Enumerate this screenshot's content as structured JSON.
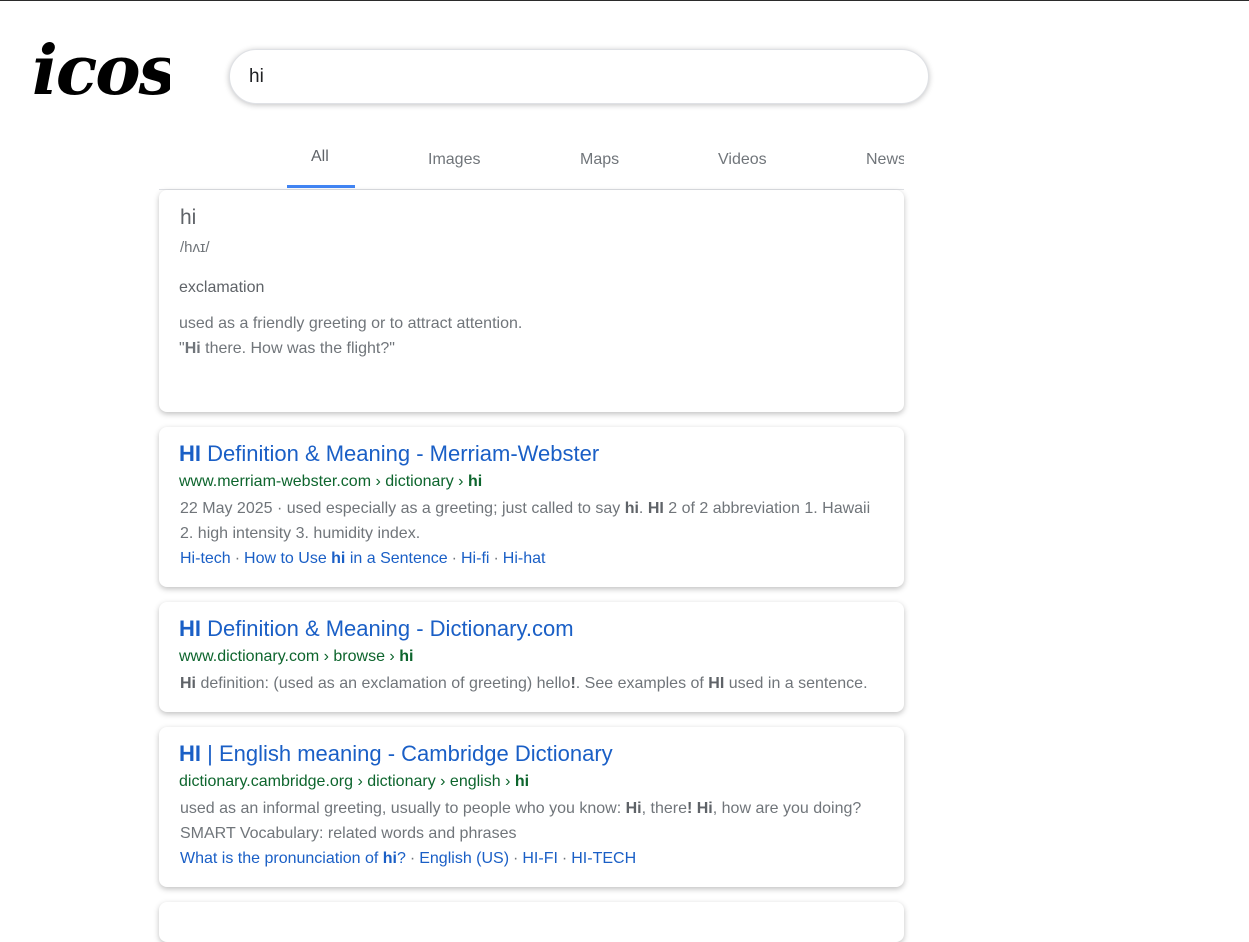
{
  "logo": {
    "text": "icos"
  },
  "search": {
    "value": "hi",
    "placeholder": ""
  },
  "tabs": [
    {
      "label": "All",
      "active": true
    },
    {
      "label": "Images",
      "active": false
    },
    {
      "label": "Maps",
      "active": false
    },
    {
      "label": "Videos",
      "active": false
    },
    {
      "label": "News",
      "active": false
    }
  ],
  "dictionary": {
    "word": "hi",
    "phonetic": "/hʌɪ/",
    "part_of_speech": "exclamation",
    "definition": "used as a friendly greeting or to attract attention.",
    "example_open": "\"",
    "example_bold": "Hi",
    "example_rest": " there. How was the flight?\""
  },
  "results": [
    {
      "title_bold": "HI",
      "title_rest": " Definition & Meaning - Merriam-Webster",
      "url_path": "www.merriam-webster.com › dictionary › ",
      "url_bold": "hi",
      "snippet_lines": [
        [
          "22 May 2025 · used especially as a greeting; just called to say ",
          "hi",
          ". ",
          "HI",
          " 2 of 2 abbreviation 1. Hawaii"
        ],
        [
          "2. high intensity 3. humidity index."
        ]
      ],
      "links": [
        "Hi-tech",
        "How to Use ",
        "hi",
        " in a Sentence",
        "Hi-fi",
        "Hi-hat"
      ]
    },
    {
      "title_bold": "HI",
      "title_rest": " Definition & Meaning - Dictionary.com",
      "url_path": "www.dictionary.com › browse › ",
      "url_bold": "hi",
      "snippet_lines": [
        [
          "Hi",
          " definition: (used as an exclamation of greeting) hello",
          "!",
          ". See examples of ",
          "HI",
          " used in a sentence."
        ]
      ]
    },
    {
      "title_bold": "HI",
      "title_rest": " | English meaning - Cambridge Dictionary",
      "url_path": "dictionary.cambridge.org › dictionary › english › ",
      "url_bold": "hi",
      "snippet_lines": [
        [
          "used as an informal greeting, usually to people who you know: ",
          "Hi",
          ", there",
          "!",
          " ",
          "Hi",
          ", how are you doing?"
        ],
        [
          "SMART Vocabulary: related words and phrases"
        ]
      ],
      "links": [
        "What is the pronunciation of ",
        "hi",
        "?",
        "English (US)",
        "HI-FI",
        "HI-TECH"
      ]
    }
  ],
  "colors": {
    "link_blue": "#1a5fc6",
    "url_green": "#0d652d",
    "tab_accent": "#4285f4",
    "text_grey": "#70757a"
  }
}
